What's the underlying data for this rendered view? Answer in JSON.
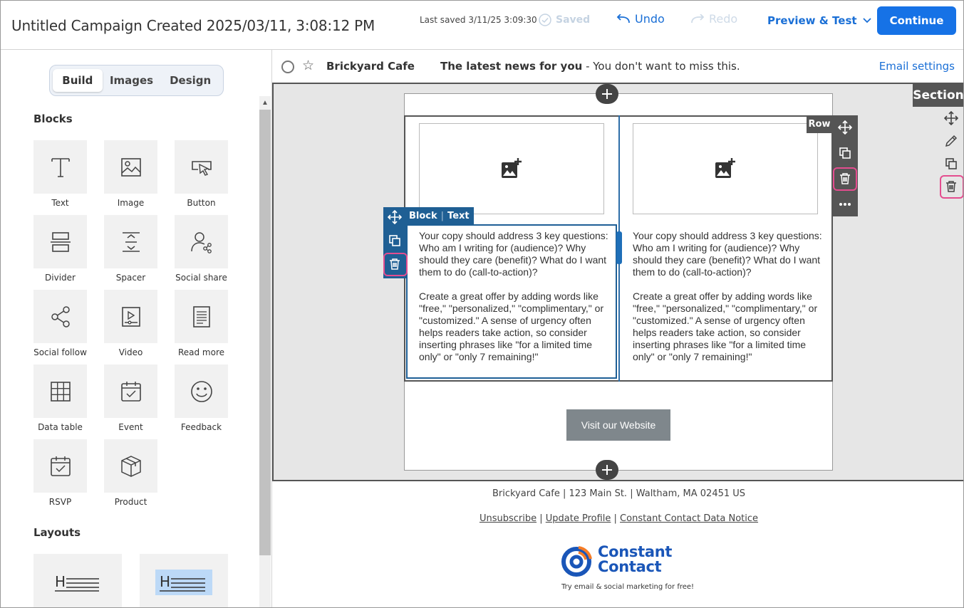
{
  "header": {
    "campaign_title": "Untitled Campaign Created 2025/03/11, 3:08:12 PM",
    "last_saved": "Last saved 3/11/25 3:09:30",
    "saved_label": "Saved",
    "undo_label": "Undo",
    "redo_label": "Redo",
    "preview_label": "Preview & Test",
    "continue_label": "Continue"
  },
  "sidebar": {
    "tabs": [
      {
        "label": "Build",
        "active": true
      },
      {
        "label": "Images",
        "active": false
      },
      {
        "label": "Design",
        "active": false
      }
    ],
    "blocks_heading": "Blocks",
    "blocks": [
      {
        "label": "Text",
        "icon": "text-icon"
      },
      {
        "label": "Image",
        "icon": "image-icon"
      },
      {
        "label": "Button",
        "icon": "button-icon"
      },
      {
        "label": "Divider",
        "icon": "divider-icon"
      },
      {
        "label": "Spacer",
        "icon": "spacer-icon"
      },
      {
        "label": "Social share",
        "icon": "social-share-icon"
      },
      {
        "label": "Social follow",
        "icon": "social-follow-icon"
      },
      {
        "label": "Video",
        "icon": "video-icon"
      },
      {
        "label": "Read more",
        "icon": "read-more-icon"
      },
      {
        "label": "Data table",
        "icon": "data-table-icon"
      },
      {
        "label": "Event",
        "icon": "event-icon"
      },
      {
        "label": "Feedback",
        "icon": "feedback-icon"
      },
      {
        "label": "RSVP",
        "icon": "rsvp-icon"
      },
      {
        "label": "Product",
        "icon": "product-icon"
      }
    ],
    "layouts_heading": "Layouts",
    "layouts": [
      {
        "letter": "H",
        "highlighted": false
      },
      {
        "letter": "H",
        "highlighted": true
      }
    ]
  },
  "subject_bar": {
    "sender": "Brickyard Cafe",
    "subject_bold": "The latest news for you",
    "subject_rest": " - You don't want to miss this.",
    "email_settings": "Email settings"
  },
  "editor": {
    "block_tag": "Block",
    "block_type": "Text",
    "row_tag": "Row",
    "section_tag": "Section",
    "copy_p1": "Your copy should address 3 key questions: Who am I writing for (audience)? Why should they care (benefit)? What do I want them to do (call-to-action)?",
    "copy_p2": "Create a great offer by adding words like \"free,\" \"personalized,\" \"complimentary,\" or \"customized.\" A sense of urgency often helps readers take action, so consider inserting phrases like \"for a limited time only\" or \"only 7 remaining!\"",
    "cta_label": "Visit our Website"
  },
  "footer": {
    "address": "Brickyard Cafe | 123 Main St. | Waltham, MA 02451 US",
    "unsubscribe": "Unsubscribe",
    "update_profile": "Update Profile",
    "data_notice": "Constant Contact Data Notice",
    "separator": " | ",
    "brand_line1": "Constant",
    "brand_line2": "Contact",
    "tagline": "Try email & social marketing for free!"
  },
  "colors": {
    "primary": "#1672e6",
    "link": "#1a6fd6",
    "block_toolbar": "#1f5f94",
    "row_toolbar": "#555555",
    "highlight": "#e44d8f",
    "cta": "#7f878c"
  }
}
